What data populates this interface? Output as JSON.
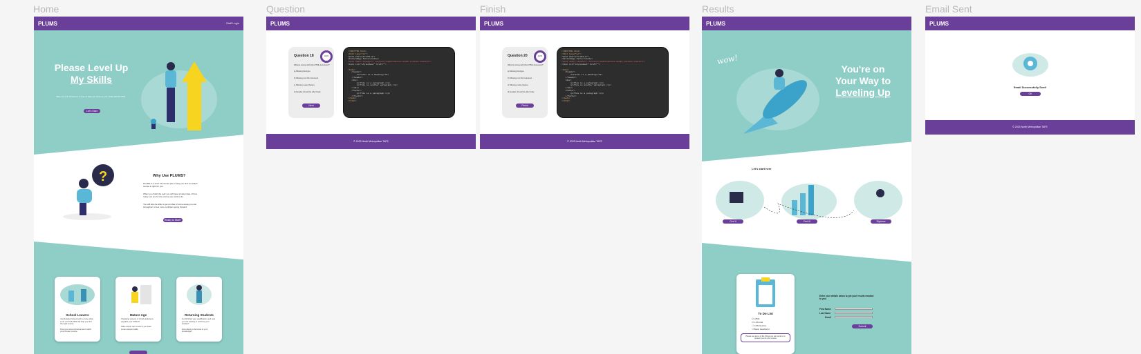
{
  "frames": {
    "home": "Home",
    "question": "Question",
    "finish": "Finish",
    "results": "Results",
    "email_sent": "Email Sent"
  },
  "brand": "PLUMS",
  "login": "Staff Login",
  "home": {
    "hero_line1": "Please Level Up",
    "hero_line2": "My Skills",
    "hero_sub": "Take our quiz and find a course to help you level up your skills with PLUMS",
    "hero_button": "Let's Start",
    "why_title": "Why Use PLUMS?",
    "why_p1": "PLUMS is a short 20 minute quiz to help you find out which course is right for you.",
    "why_p2": "When you finish the quiz you will have a better idea of how ready you are for the course you want to do.",
    "why_p3": "You will also be able to get an idea of some areas you can strengthen to feel more confident going forward.",
    "why_button": "Ready to Start?",
    "cards": [
      {
        "title": "School Leavers",
        "text": "Just finished school and not sure what to do next? PLUMS will help you find the right course.",
        "text2": "Find your area of interest and match your chosen course."
      },
      {
        "title": "Mature Age",
        "text": "Changing careers or simply looking to upgrade your skillset?",
        "text2": "Take a short quiz to see if you have some relevant skills."
      },
      {
        "title": "Returning Students",
        "text": "Got finished your qualification and now you are looking to continue your studies?",
        "text2": "How about a short test of your knowledge?"
      }
    ]
  },
  "question": {
    "title": "Question 18",
    "progress": "18/20",
    "prompt": "What is wrong with this HTML document?",
    "options": [
      "a) Missing Doctype",
      "b) Missing root html element",
      "c) Missing meta charset",
      "d) Header should be after body"
    ],
    "button": "Next"
  },
  "finish": {
    "title": "Question 20",
    "progress": "20/20",
    "prompt": "What is wrong with this HTML document?",
    "options": [
      "a) Missing Doctype",
      "b) Missing root html element",
      "c) Missing meta charset",
      "d) Header should be after body"
    ],
    "button": "Finish"
  },
  "code_lines": [
    "<!DOCTYPE html>",
    "<html lang=\"en\">",
    "<meta charset=\"UTF-8\">",
    "<title>Page Title</title>",
    "<meta name=\"viewport\" content=\"width=device-width,initial-scale=1\">",
    "<link rel=\"stylesheet\" href=\"\">",
    "",
    "<body>",
    "   <header>",
    "       <h1>This is a Heading</h1>",
    "   </header>",
    "   <div>",
    "       <p>This is a paragraph.</p>",
    "       <p>This is another paragraph.</p>",
    "   </div>",
    "   <footer>",
    "       <p>This is a paragraph.</p>",
    "   </footer>",
    "</body>",
    "</html>"
  ],
  "footer": "© 2023 North Metropolitan TAFE",
  "results": {
    "wow": "wow!",
    "hero_line1": "You're on",
    "hero_line2": "Your Way to",
    "hero_line3": "Leveling Up",
    "start_here": "Let's start here",
    "levels": [
      "Cert II",
      "Cert III",
      "Diploma"
    ],
    "todo_title": "To Do List",
    "todo_items": [
      "HTML",
      "CSS Grid",
      "CSS Flexbox",
      "Basic JavaScript"
    ],
    "todo_note": "Please see some of the things you can work on to prepare you for your course",
    "form_intro": "Enter your details below to get your results emailed to you.",
    "first_name": "First Name",
    "last_name": "Last Name",
    "email": "Email",
    "submit": "Submit"
  },
  "email_sent": {
    "message": "Email Successfully Sent!",
    "button": "OK"
  },
  "colors": {
    "purple": "#6a3f99",
    "teal": "#8fcdc7",
    "yellow": "#f6d420"
  }
}
